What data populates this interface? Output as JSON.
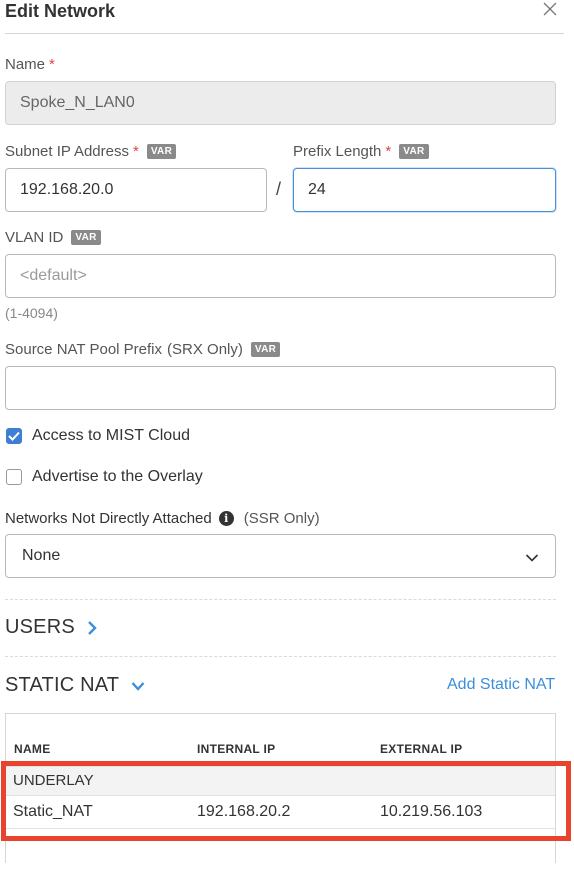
{
  "dialog": {
    "title": "Edit Network",
    "close_icon": "close-icon"
  },
  "form": {
    "name": {
      "label": "Name",
      "required_mark": "*",
      "value": "Spoke_N_LAN0"
    },
    "subnet": {
      "label": "Subnet IP Address",
      "required_mark": "*",
      "var_badge": "VAR",
      "value": "192.168.20.0"
    },
    "separator": "/",
    "prefix": {
      "label": "Prefix Length",
      "required_mark": "*",
      "var_badge": "VAR",
      "value": "24"
    },
    "vlan": {
      "label": "VLAN ID",
      "var_badge": "VAR",
      "placeholder": "<default>",
      "hint": "(1-4094)"
    },
    "source_nat": {
      "label": "Source NAT Pool Prefix",
      "label_suffix": "(SRX Only)",
      "var_badge": "VAR",
      "value": ""
    },
    "access_mist": {
      "label": "Access to MIST Cloud",
      "checked": true
    },
    "advertise_overlay": {
      "label": "Advertise to the Overlay",
      "checked": false
    },
    "networks_not_attached": {
      "label": "Networks Not Directly Attached",
      "info_icon": "info-icon",
      "label_suffix": "(SSR Only)",
      "selected": "None"
    }
  },
  "sections": {
    "users": {
      "title": "USERS",
      "icon": "chevron-right-icon"
    },
    "static_nat": {
      "title": "STATIC NAT",
      "icon": "chevron-down-icon",
      "add_label": "Add Static NAT"
    }
  },
  "static_nat_table": {
    "columns": [
      "NAME",
      "INTERNAL IP",
      "EXTERNAL IP"
    ],
    "group": "UNDERLAY",
    "rows": [
      {
        "name": "Static_NAT",
        "internal_ip": "192.168.20.2",
        "external_ip": "10.219.56.103"
      }
    ]
  },
  "colors": {
    "accent": "#3b8fd9",
    "required": "#e0463a",
    "highlight": "#e8432e",
    "checkbox": "#3e7fd3"
  }
}
